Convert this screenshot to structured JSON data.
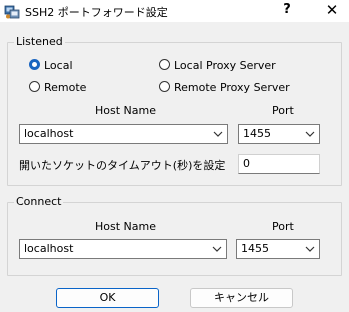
{
  "window": {
    "title": "SSH2 ポートフォワード設定",
    "help_glyph": "?",
    "close_glyph": "✕"
  },
  "listened": {
    "group_label": "Listened",
    "radios": [
      {
        "label": "Local",
        "checked": true
      },
      {
        "label": "Local Proxy Server",
        "checked": false
      },
      {
        "label": "Remote",
        "checked": false
      },
      {
        "label": "Remote Proxy Server",
        "checked": false
      }
    ],
    "host_header": "Host Name",
    "port_header": "Port",
    "host_value": "localhost",
    "port_value": "1455",
    "timeout_label": "開いたソケットのタイムアウト(秒)を設定",
    "timeout_value": "0"
  },
  "connect": {
    "group_label": "Connect",
    "host_header": "Host Name",
    "port_header": "Port",
    "host_value": "localhost",
    "port_value": "1455"
  },
  "buttons": {
    "ok": "OK",
    "cancel": "キャンセル"
  }
}
